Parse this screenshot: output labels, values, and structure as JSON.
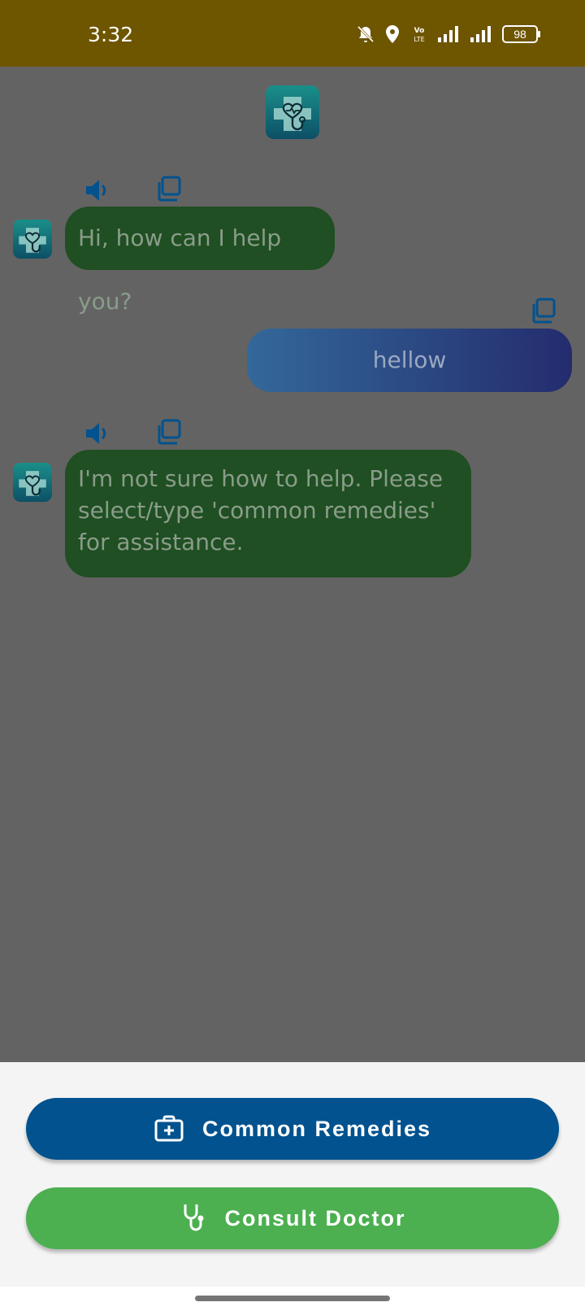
{
  "status_bar": {
    "time": "3:32",
    "battery": "98",
    "icons": [
      "bell-off-icon",
      "location-icon",
      "volte-icon",
      "signal-icon",
      "signal-icon",
      "battery-icon"
    ]
  },
  "chat": {
    "messages": [
      {
        "sender": "bot",
        "text": "Hi, how can I help you?"
      },
      {
        "sender": "user",
        "text": "hellow"
      },
      {
        "sender": "bot",
        "text": "I'm not sure how to help. Please select/type 'common remedies' for assistance."
      }
    ]
  },
  "actions": {
    "remedies_label": "Common Remedies",
    "doctor_label": "Consult Doctor"
  },
  "colors": {
    "status_bar": "#6e5500",
    "bot_bubble": "#1f4f22",
    "remedies_button": "#01528f",
    "doctor_button": "#4caf50",
    "icon_blue": "#01528f"
  }
}
